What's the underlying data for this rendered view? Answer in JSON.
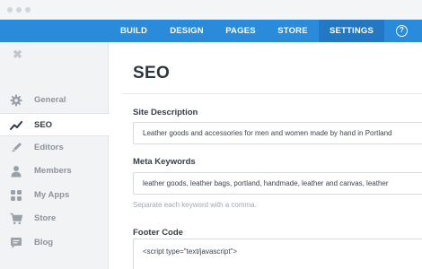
{
  "navbar": {
    "tabs": [
      {
        "label": "BUILD"
      },
      {
        "label": "DESIGN"
      },
      {
        "label": "PAGES"
      },
      {
        "label": "STORE"
      },
      {
        "label": "SETTINGS",
        "active": true
      }
    ],
    "help_label": "?"
  },
  "sidebar": {
    "close_glyph": "✖",
    "items": [
      {
        "label": "General",
        "icon": "gear-icon"
      },
      {
        "label": "SEO",
        "icon": "trending-line-icon",
        "active": true
      },
      {
        "label": "Editors",
        "icon": "pencil-icon"
      },
      {
        "label": "Members",
        "icon": "person-icon"
      },
      {
        "label": "My Apps",
        "icon": "grid-icon"
      },
      {
        "label": "Store",
        "icon": "cart-icon"
      },
      {
        "label": "Blog",
        "icon": "speech-bubble-icon"
      }
    ]
  },
  "main": {
    "title": "SEO",
    "site_description": {
      "label": "Site Description",
      "value": "Leather goods and accessories for men and women made by hand in Portland"
    },
    "meta_keywords": {
      "label": "Meta Keywords",
      "value": "leather goods, leather bags, portland, handmade, leather and canvas, leather",
      "hint": "Separate each keyword with a comma."
    },
    "footer_code": {
      "label": "Footer Code",
      "value": "<script type=\"text/javascript\">"
    }
  },
  "colors": {
    "nav_bar": "#2a8bdb",
    "nav_active": "#2378c4",
    "sidebar_bg": "#f2f3f5"
  }
}
